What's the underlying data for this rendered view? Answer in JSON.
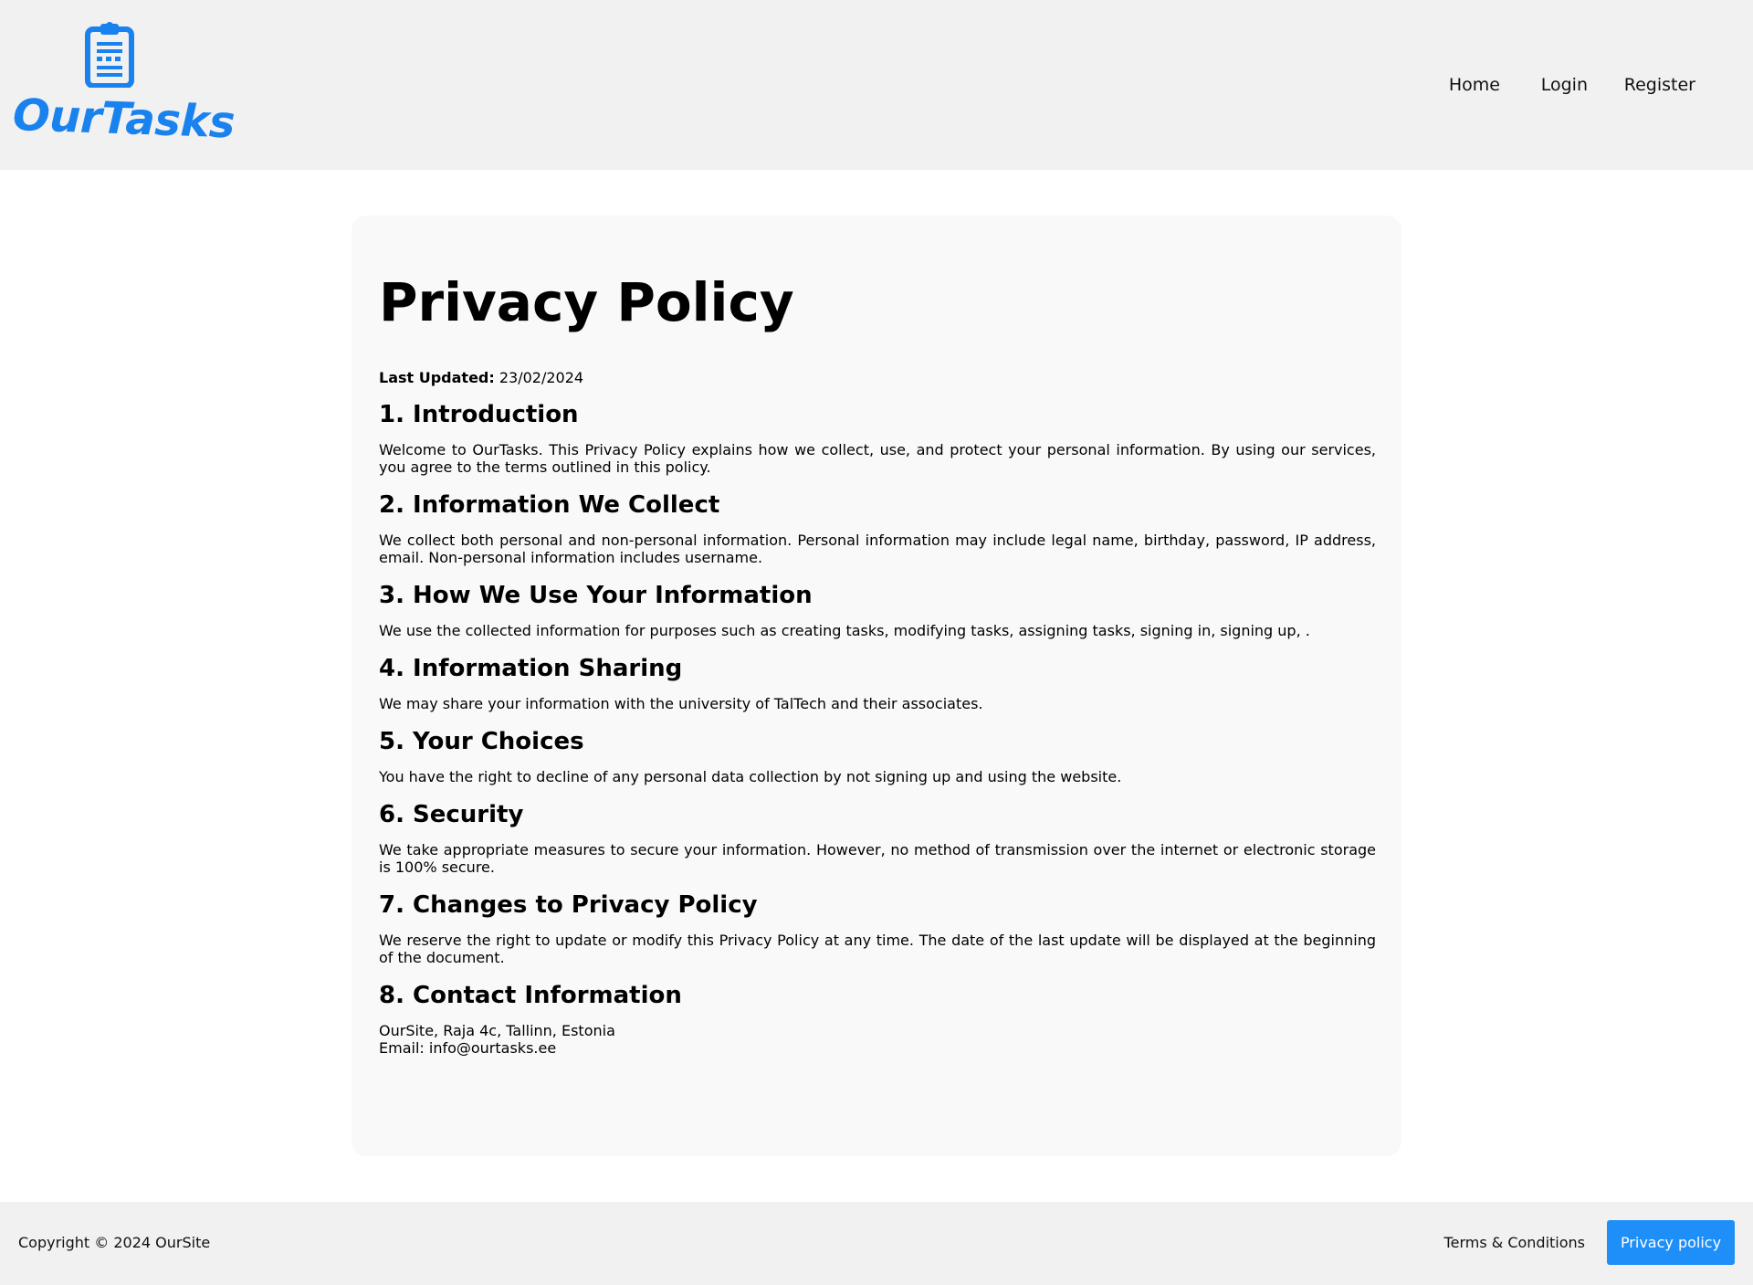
{
  "header": {
    "logo_text": "OurTasks",
    "brand_color": "#1a82ee",
    "logo_icon": "clipboard-icon",
    "nav": {
      "home": "Home",
      "login": "Login",
      "register": "Register"
    }
  },
  "main": {
    "title": "Privacy Policy",
    "last_updated_label": "Last Updated:",
    "last_updated_value": " 23/02/2024",
    "sections": [
      {
        "heading": "1. Introduction",
        "body": "Welcome to OurTasks. This Privacy Policy explains how we collect, use, and protect your personal information. By using our services, you agree to the terms outlined in this policy."
      },
      {
        "heading": "2. Information We Collect",
        "body": "We collect both personal and non-personal information. Personal information may include legal name, birthday, password, IP address, email. Non-personal information includes username."
      },
      {
        "heading": "3. How We Use Your Information",
        "body": "We use the collected information for purposes such as creating tasks, modifying tasks, assigning tasks, signing in, signing up, ."
      },
      {
        "heading": "4. Information Sharing",
        "body": "We may share your information with the university of TalTech and their associates."
      },
      {
        "heading": "5. Your Choices",
        "body": "You have the right to decline of any personal data collection by not signing up and using the website."
      },
      {
        "heading": "6. Security",
        "body": "We take appropriate measures to secure your information. However, no method of transmission over the internet or electronic storage is 100% secure."
      },
      {
        "heading": "7. Changes to Privacy Policy",
        "body": "We reserve the right to update or modify this Privacy Policy at any time. The date of the last update will be displayed at the beginning of the document."
      },
      {
        "heading": "8. Contact Information",
        "address": "OurSite, Raja 4c, Tallinn, Estonia",
        "email": "Email: info@ourtasks.ee"
      }
    ]
  },
  "footer": {
    "copyright": "Copyright © 2024 OurSite",
    "terms_link": "Terms & Conditions",
    "privacy_button": "Privacy policy",
    "privacy_button_color": "#1e8ef9"
  }
}
